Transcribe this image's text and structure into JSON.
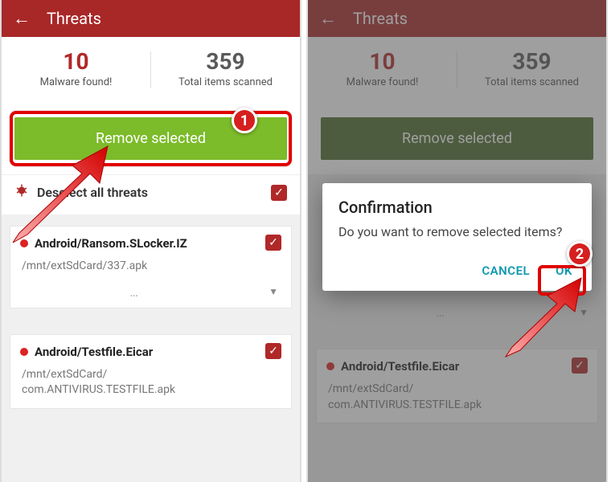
{
  "screen1": {
    "header": {
      "title": "Threats"
    },
    "stats": {
      "malware_count": "10",
      "malware_label": "Malware found!",
      "total_count": "359",
      "total_label": "Total items scanned"
    },
    "remove_button": "Remove selected",
    "deselect_label": "Deselect all threats",
    "threats": [
      {
        "name": "Android/Ransom.SLocker.IZ",
        "path": "/mnt/extSdCard/337.apk"
      },
      {
        "name": "Android/Testfile.Eicar",
        "path": "/mnt/extSdCard/\ncom.ANTIVIRUS.TESTFILE.apk"
      }
    ],
    "step_badge": "1"
  },
  "screen2": {
    "header": {
      "title": "Threats"
    },
    "stats": {
      "malware_count": "10",
      "malware_label": "Malware found!",
      "total_count": "359",
      "total_label": "Total items scanned"
    },
    "remove_button": "Remove selected",
    "dialog": {
      "title": "Confirmation",
      "body": "Do you want to remove selected items?",
      "cancel": "CANCEL",
      "ok": "OK"
    },
    "threats": [
      {
        "name": "Android/Testfile.Eicar",
        "path": "/mnt/extSdCard/\ncom.ANTIVIRUS.TESTFILE.apk"
      }
    ],
    "step_badge": "2"
  },
  "colors": {
    "accent_red": "#a82828",
    "accent_green": "#7cbb29",
    "highlight": "#e10000",
    "teal": "#0f98b0"
  }
}
